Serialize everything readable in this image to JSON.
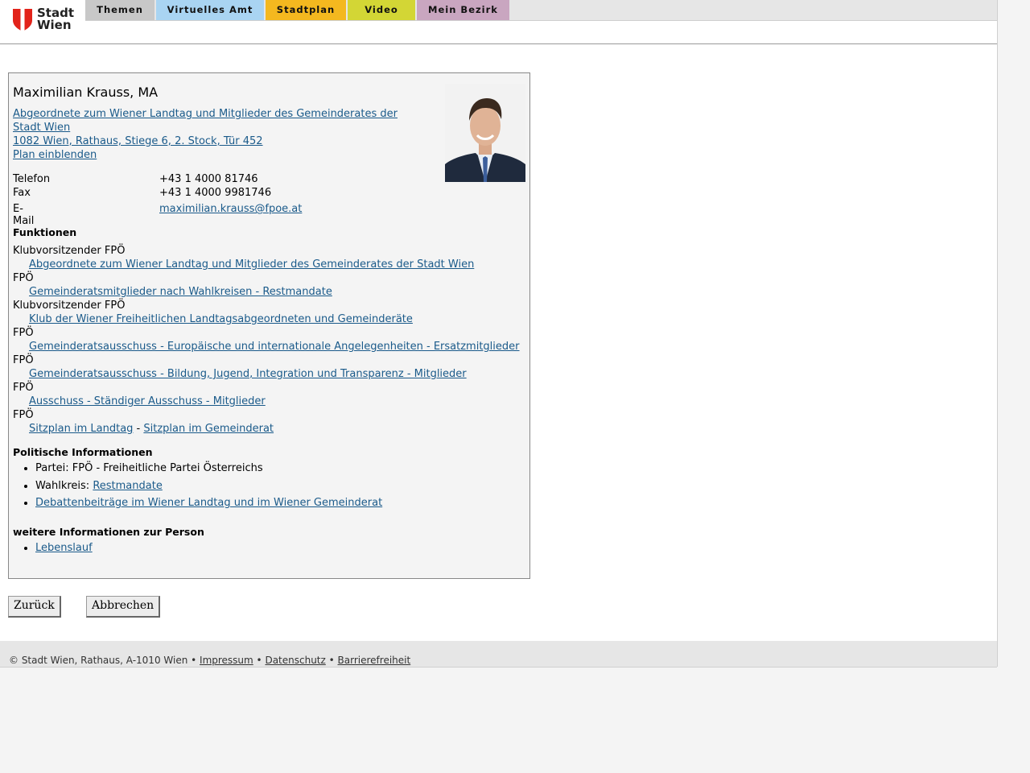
{
  "header": {
    "logo_line1": "Stadt",
    "logo_line2": "Wien",
    "tabs": [
      {
        "label": "Themen",
        "color": "#c8c8c8"
      },
      {
        "label": "Virtuelles Amt",
        "color": "#a9d4f2"
      },
      {
        "label": "Stadtplan",
        "color": "#f4b81f"
      },
      {
        "label": "Video",
        "color": "#d3d635"
      },
      {
        "label": "Mein Bezirk",
        "color": "#c9a6c0"
      }
    ]
  },
  "person": {
    "name": "Maximilian Krauss, MA",
    "org_line1": "Abgeordnete zum Wiener Landtag und Mitglieder des Gemeinderates der",
    "org_line2": "Stadt Wien ",
    "address": "1082 Wien, Rathaus, Stiege 6, 2. Stock, Tür 452",
    "plan_link": "Plan einblenden"
  },
  "contact": {
    "phone_label": "Telefon",
    "phone": "+43 1 4000 81746",
    "fax_label": "Fax",
    "fax": "+43 1 4000 9981746",
    "email_label": "E-Mail",
    "email": "maximilian.krauss@fpoe.at"
  },
  "functions": {
    "heading": "Funktionen",
    "items": [
      {
        "role": "Klubvorsitzender FPÖ",
        "link": "Abgeordnete zum Wiener Landtag und Mitglieder des Gemeinderates der Stadt Wien"
      },
      {
        "role": "FPÖ",
        "link": "Gemeinderatsmitglieder nach Wahlkreisen - Restmandate"
      },
      {
        "role": "Klubvorsitzender FPÖ",
        "link": "Klub der Wiener Freiheitlichen Landtagsabgeordneten und Gemeinderäte"
      },
      {
        "role": "FPÖ",
        "link": "Gemeinderatsausschuss - Europäische und internationale Angelegenheiten - Ersatzmitglieder"
      },
      {
        "role": "FPÖ",
        "link": "Gemeinderatsausschuss - Bildung, Jugend, Integration und Transparenz - Mitglieder"
      },
      {
        "role": "FPÖ",
        "link": "Ausschuss - Ständiger Ausschuss - Mitglieder"
      }
    ],
    "last_role": "FPÖ",
    "seat_landtag": "Sitzplan im Landtag",
    "seat_sep": " - ",
    "seat_gemeinderat": "Sitzplan im Gemeinderat"
  },
  "political": {
    "heading": "Politische Informationen",
    "party": "Partei: FPÖ - Freiheitliche Partei Österreichs",
    "district_label": "Wahlkreis: ",
    "district_link": "Restmandate",
    "debates_link": "Debattenbeiträge im Wiener Landtag und im Wiener Gemeinderat"
  },
  "more": {
    "heading": "weitere Informationen zur Person",
    "cv_link": "Lebenslauf"
  },
  "buttons": {
    "back": "Zurück",
    "cancel": "Abbrechen"
  },
  "footer": {
    "copyright": "© Stadt Wien, Rathaus, A-1010 Wien",
    "sep": " • ",
    "impressum": "Impressum",
    "datenschutz": "Datenschutz",
    "barrierefreiheit": "Barrierefreiheit"
  }
}
